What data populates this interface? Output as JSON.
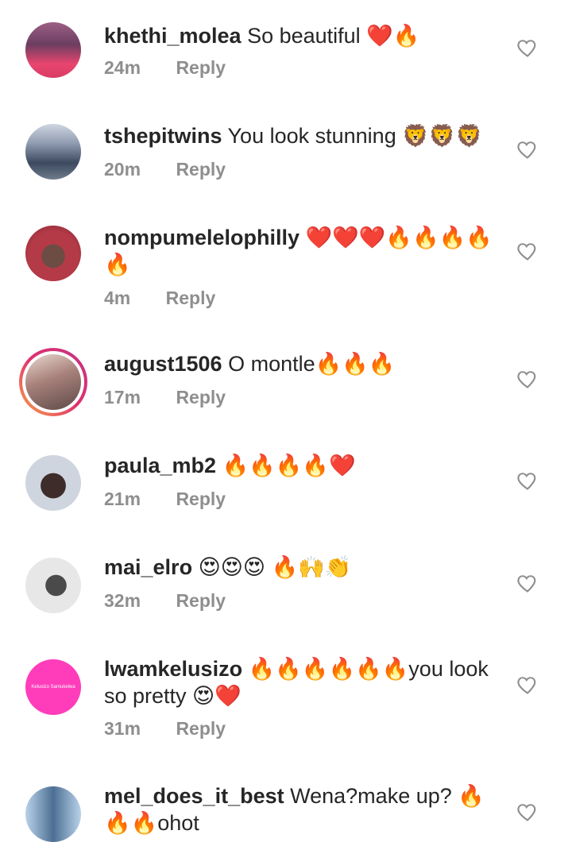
{
  "comments": [
    {
      "username": "khethi_molea",
      "text": "So beautiful ❤️🔥",
      "time": "24m",
      "reply": "Reply"
    },
    {
      "username": "tshepitwins",
      "text": "You look stunning 🦁🦁🦁",
      "time": "20m",
      "reply": "Reply"
    },
    {
      "username": "nompumelelophilly",
      "text": "❤️❤️❤️🔥🔥🔥🔥🔥",
      "time": "4m",
      "reply": "Reply"
    },
    {
      "username": "august1506",
      "text": "O montle🔥🔥🔥",
      "time": "17m",
      "reply": "Reply"
    },
    {
      "username": "paula_mb2",
      "text": "🔥🔥🔥🔥❤️",
      "time": "21m",
      "reply": "Reply"
    },
    {
      "username": "mai_elro",
      "text": "😍😍😍 🔥🙌👏",
      "time": "32m",
      "reply": "Reply"
    },
    {
      "username": "lwamkelusizo",
      "text": "🔥🔥🔥🔥🔥🔥you look so pretty 😍❤️",
      "time": "31m",
      "reply": "Reply",
      "avatar_text": "Kelusizo Samukelwa"
    },
    {
      "username": "mel_does_it_best",
      "text": "Wena?make up? 🔥🔥🔥ohot",
      "time": "",
      "reply": ""
    }
  ],
  "icons": {
    "like": "heart-outline-icon"
  },
  "colors": {
    "text": "#262626",
    "meta": "#8e8e8e",
    "avatar_ring_start": "#f9a54a",
    "avatar_ring_end": "#c13584"
  }
}
